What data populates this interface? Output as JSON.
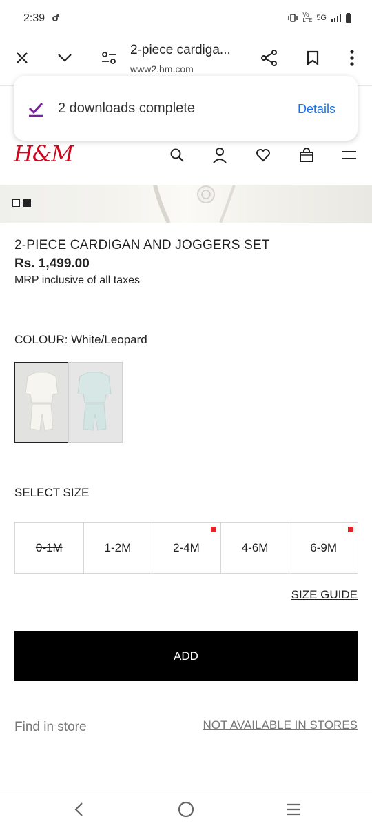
{
  "status_bar": {
    "time": "2:39",
    "network_label": "5G",
    "volte_label": "Vo LTE"
  },
  "browser": {
    "title": "2-piece cardiga...",
    "url": "www2.hm.com",
    "icons": [
      "close-icon",
      "chevron-down-icon",
      "page-settings-icon",
      "share-icon",
      "bookmark-icon",
      "more-menu-icon"
    ]
  },
  "toast": {
    "message": "2 downloads complete",
    "action": "Details"
  },
  "brand": {
    "logo_text": "H&M",
    "logo_color": "#cc071e"
  },
  "product": {
    "title": "2-PIECE CARDIGAN AND JOGGERS SET",
    "price": "Rs. 1,499.00",
    "tax_note": "MRP inclusive of all taxes",
    "colour_label": "COLOUR: White/Leopard",
    "size_label": "SELECT SIZE",
    "sizes": [
      {
        "label": "0-1M",
        "available": false,
        "low_stock": false
      },
      {
        "label": "1-2M",
        "available": true,
        "low_stock": false
      },
      {
        "label": "2-4M",
        "available": true,
        "low_stock": true
      },
      {
        "label": "4-6M",
        "available": true,
        "low_stock": false
      },
      {
        "label": "6-9M",
        "available": true,
        "low_stock": true
      }
    ],
    "size_guide": "SIZE GUIDE",
    "add_button": "ADD",
    "find_in_store": "Find in store",
    "store_availability": "NOT AVAILABLE IN STORES"
  },
  "colors": {
    "accent_link": "#1a73e8",
    "check_purple": "#7b1fa2",
    "low_stock_red": "#e0262b"
  }
}
